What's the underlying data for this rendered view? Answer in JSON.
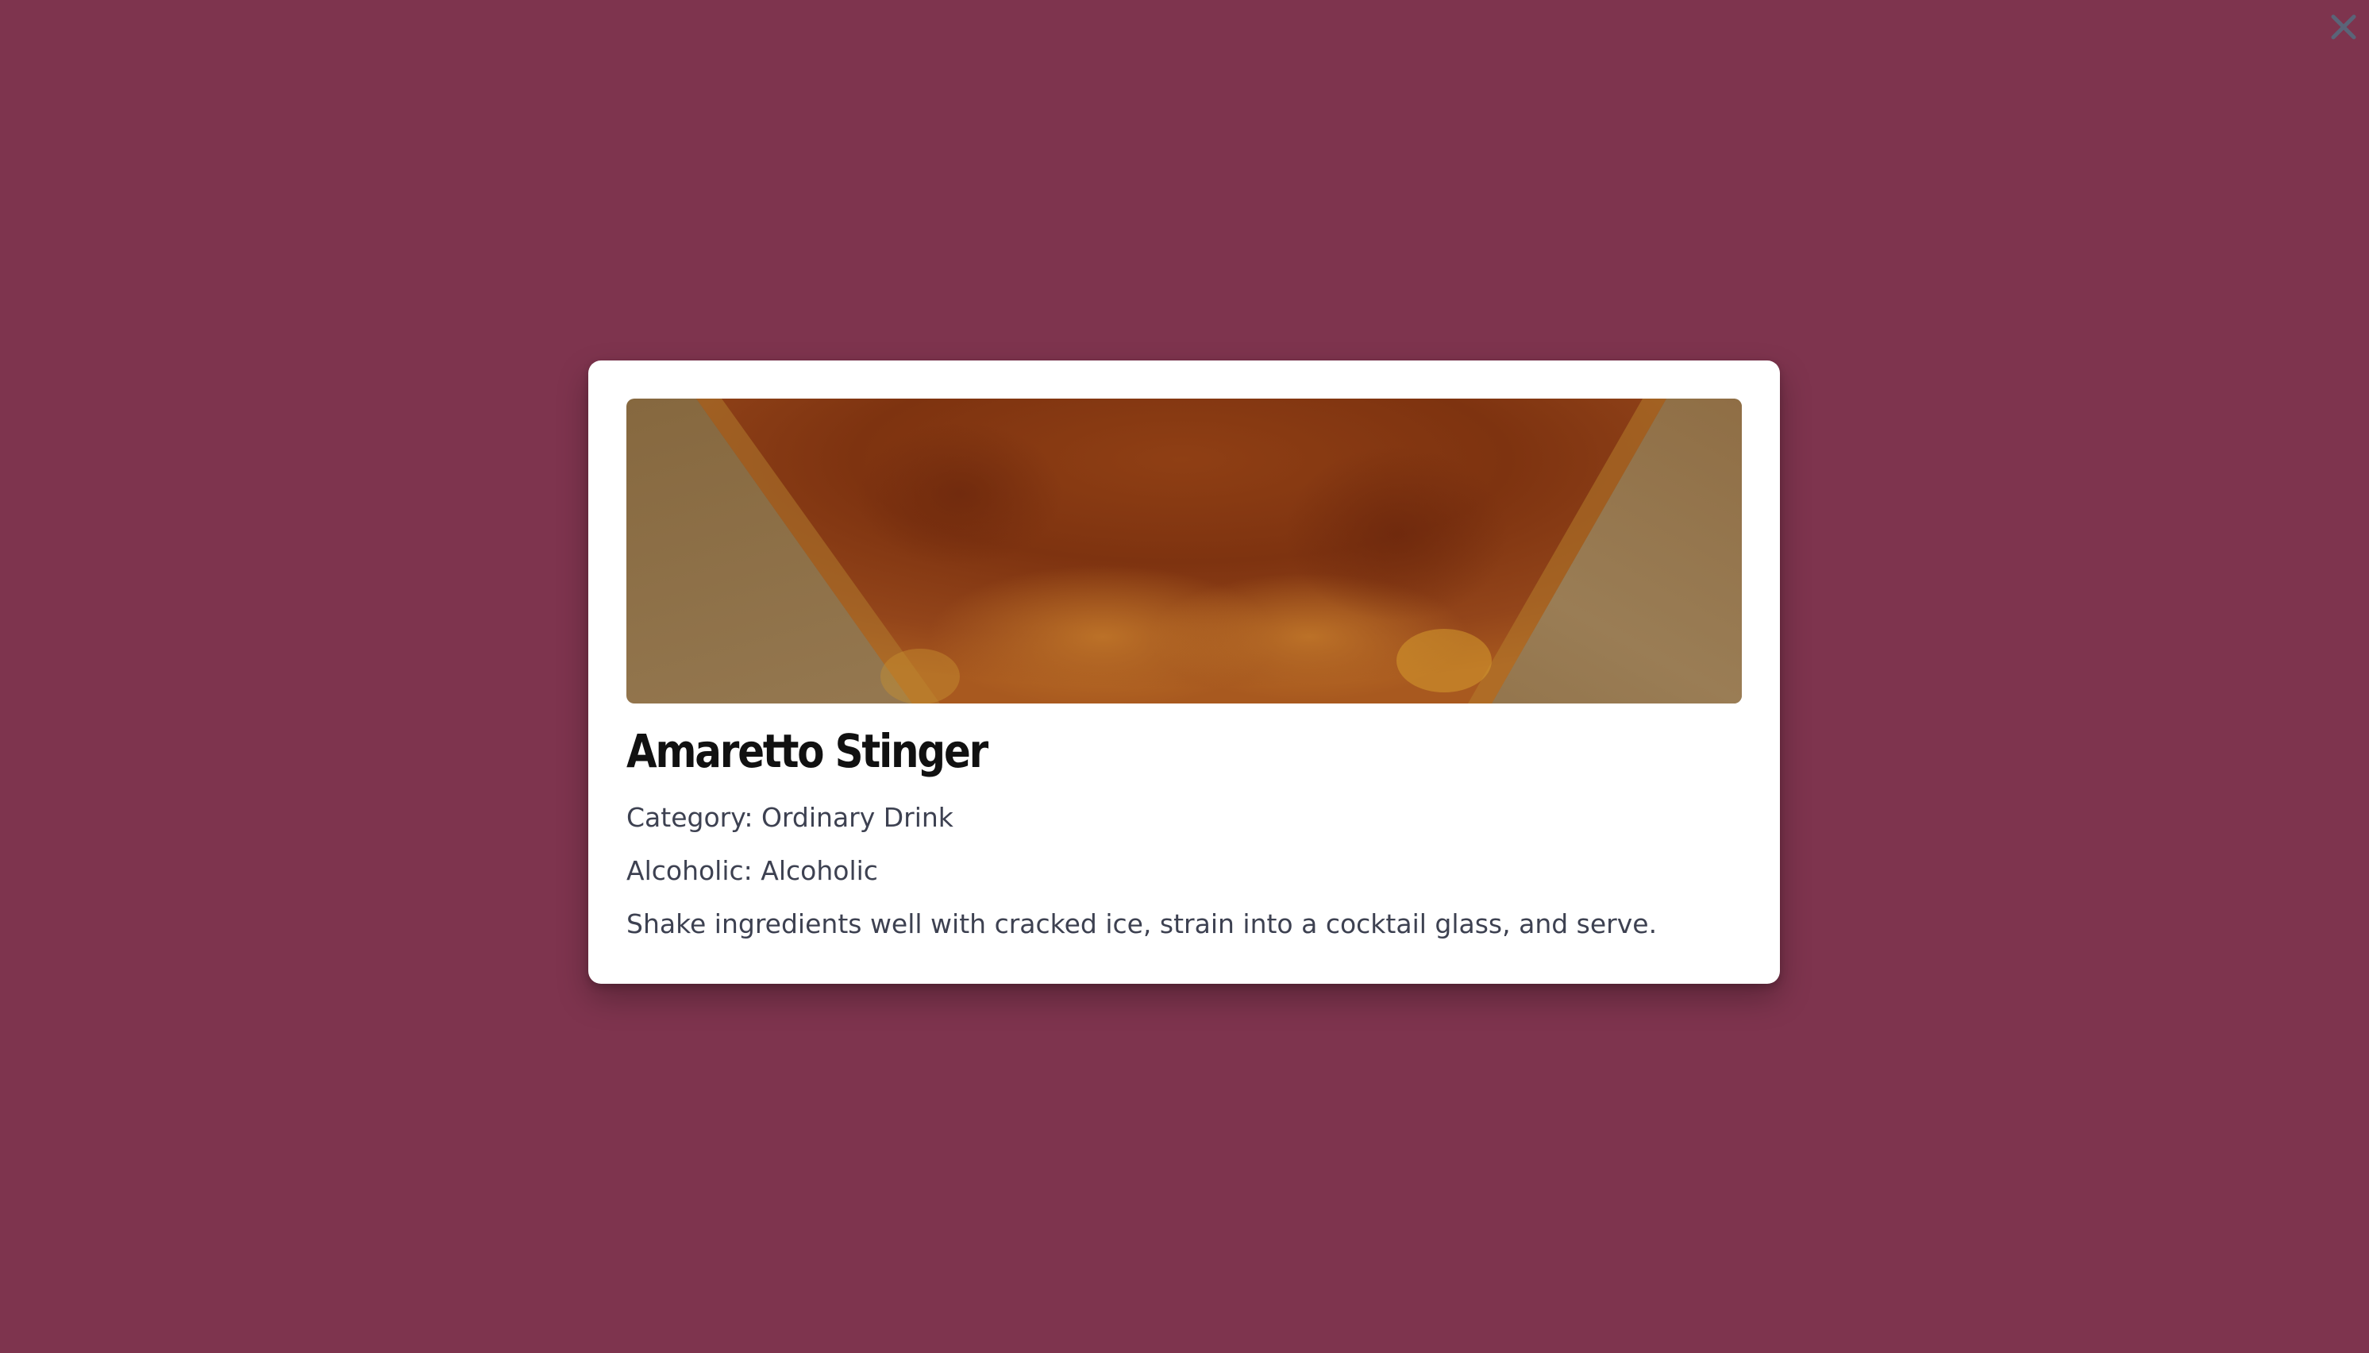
{
  "background_color": "#7e344e",
  "close_button": {
    "icon": "close-icon",
    "color": "#5a6478"
  },
  "modal": {
    "image": {
      "description": "overhead view of amber cocktail in a glass",
      "colors": {
        "liquid": "#8c3e12",
        "side": "#8c6c46",
        "highlight": "#c98a2c"
      }
    },
    "title": "Amaretto Stinger",
    "category": "Category: Ordinary Drink",
    "alcoholic": "Alcoholic: Alcoholic",
    "instructions": "Shake ingredients well with cracked ice, strain into a cocktail glass, and serve."
  }
}
